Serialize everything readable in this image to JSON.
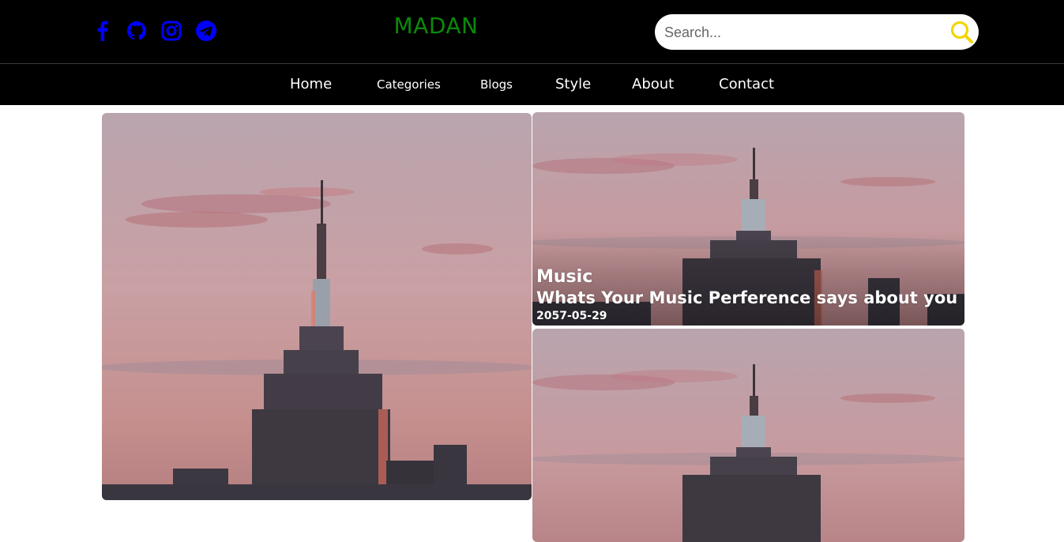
{
  "header": {
    "brand": "MADAN",
    "social_icons": [
      "facebook-icon",
      "github-icon",
      "instagram-icon",
      "telegram-icon"
    ],
    "search": {
      "placeholder": "Search..."
    },
    "colors": {
      "background": "#000000",
      "brand": "#0a8a0a",
      "social": "#0000ff",
      "search_icon": "#f2d600"
    }
  },
  "nav": {
    "items": [
      "Home",
      "Categories",
      "Blogs",
      "Style",
      "About",
      "Contact"
    ]
  },
  "cards": [
    {
      "category": "Music",
      "title": "Whats Your Music Perference says about you",
      "date": "2057-05-29"
    }
  ]
}
